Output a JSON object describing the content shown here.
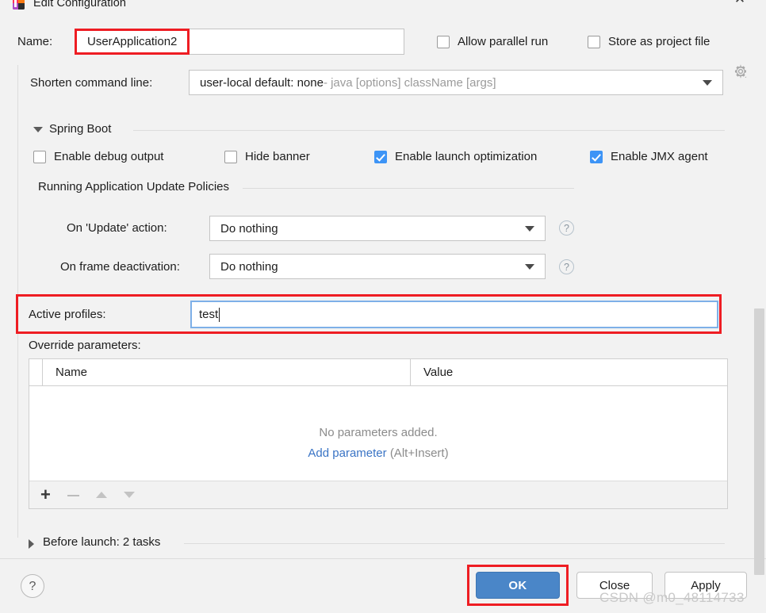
{
  "window": {
    "title": "Edit Configuration",
    "app_icon": "intellij-idea-icon",
    "close_icon": "close-icon"
  },
  "name_row": {
    "label": "Name:",
    "value": "UserApplication2",
    "placeholder": "",
    "allow_parallel_run": {
      "label": "Allow parallel run",
      "checked": false
    },
    "store_as_project_file": {
      "label": "Store as project file",
      "checked": false
    },
    "gear_icon": "gear-icon"
  },
  "shorten_command_line": {
    "label": "Shorten command line:",
    "value_strong": "user-local default: none",
    "value_muted": " - java [options] className [args]",
    "arrow_icon": "chevron-down-icon"
  },
  "spring_boot": {
    "group_label": "Spring Boot",
    "expanded": true,
    "checkboxes": [
      {
        "label": "Enable debug output",
        "checked": false
      },
      {
        "label": "Hide banner",
        "checked": false
      },
      {
        "label": "Enable launch optimization",
        "checked": true
      },
      {
        "label": "Enable JMX agent",
        "checked": true
      }
    ],
    "update_policies": {
      "group_label": "Running Application Update Policies",
      "rows": [
        {
          "label": "On 'Update' action:",
          "value": "Do nothing",
          "help_icon": "help-icon"
        },
        {
          "label": "On frame deactivation:",
          "value": "Do nothing",
          "help_icon": "help-icon"
        }
      ]
    }
  },
  "active_profiles": {
    "label": "Active profiles:",
    "value": "test",
    "placeholder": ""
  },
  "override_parameters": {
    "label": "Override parameters:",
    "columns": [
      "Name",
      "Value"
    ],
    "rows": [],
    "empty_text": "No parameters added.",
    "add_link": "Add parameter",
    "add_shortcut": "(Alt+Insert)",
    "toolbar": {
      "add": "+",
      "remove": "−",
      "move_up": "▲",
      "move_down": "▼"
    }
  },
  "before_launch": {
    "label": "Before launch: 2 tasks",
    "expanded": false
  },
  "footer": {
    "help_label": "?",
    "ok_label": "OK",
    "close_label": "Close",
    "apply_label": "Apply"
  },
  "watermark": {
    "text": "CSDN @m0_48114733"
  },
  "colors": {
    "accent_blue": "#4a86c8",
    "checkbox_checked": "#3d94f6",
    "link_blue": "#3a74c5",
    "highlight_red": "#ee1d23",
    "focus_border": "#7eb0e8",
    "background": "#f2f2f2"
  }
}
